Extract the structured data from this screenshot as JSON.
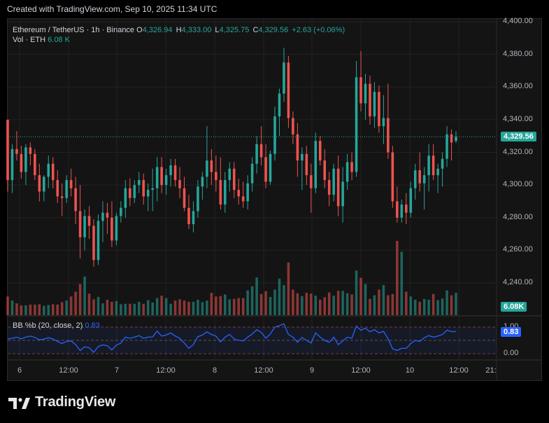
{
  "header": {
    "text": "Created with TradingView.com, Sep 10, 2025 11:34 UTC"
  },
  "legend": {
    "symbol": "Ethereum / TetherUS · 1h · Binance",
    "o_label": "O",
    "o": "4,326.94",
    "h_label": "H",
    "h": "4,333.00",
    "l_label": "L",
    "l": "4,325.75",
    "c_label": "C",
    "c": "4,329.56",
    "change": "+2.63 (+0.06%)",
    "vol_label": "Vol · ETH",
    "vol": "6.08 K"
  },
  "bb": {
    "label": "BB %b (20, close, 2)",
    "value": "0.83"
  },
  "badges": {
    "price": "4,329.56",
    "volume": "6.08K",
    "bb": "0.83"
  },
  "logo": {
    "text": "TradingView"
  },
  "colors": {
    "up": "#26a69a",
    "down": "#ef5350",
    "bb_line": "#2962ff",
    "bg": "#141414",
    "grid": "#222222"
  },
  "chart_data": {
    "type": "candlestick",
    "price_axis": {
      "labels": [
        "4,400.00",
        "4,380.00",
        "4,360.00",
        "4,340.00",
        "4,320.00",
        "4,300.00",
        "4,280.00",
        "4,260.00",
        "4,240.00"
      ],
      "ylim": [
        4231,
        4400
      ]
    },
    "bb_axis": {
      "labels": [
        "1.00",
        "0.00"
      ]
    },
    "time_axis": {
      "labels": [
        "6",
        "12:00",
        "7",
        "12:00",
        "8",
        "12:00",
        "9",
        "12:00",
        "10",
        "12:00",
        "21:"
      ]
    },
    "last_close": 4329.56,
    "candles_count": 100,
    "ohlc": [
      [
        4340,
        4340,
        4296,
        4303
      ],
      [
        4303,
        4325,
        4295,
        4322
      ],
      [
        4322,
        4333,
        4315,
        4319
      ],
      [
        4319,
        4324,
        4304,
        4308
      ],
      [
        4308,
        4325,
        4300,
        4323
      ],
      [
        4323,
        4326,
        4312,
        4319
      ],
      [
        4319,
        4322,
        4303,
        4306
      ],
      [
        4306,
        4313,
        4290,
        4296
      ],
      [
        4296,
        4306,
        4290,
        4305
      ],
      [
        4305,
        4318,
        4298,
        4313
      ],
      [
        4313,
        4317,
        4298,
        4303
      ],
      [
        4303,
        4309,
        4289,
        4293
      ],
      [
        4293,
        4301,
        4281,
        4292
      ],
      [
        4292,
        4306,
        4289,
        4303
      ],
      [
        4303,
        4310,
        4293,
        4298
      ],
      [
        4298,
        4305,
        4276,
        4284
      ],
      [
        4284,
        4300,
        4255,
        4268
      ],
      [
        4268,
        4285,
        4260,
        4281
      ],
      [
        4281,
        4287,
        4267,
        4275
      ],
      [
        4275,
        4279,
        4250,
        4254
      ],
      [
        4254,
        4282,
        4251,
        4278
      ],
      [
        4278,
        4290,
        4265,
        4283
      ],
      [
        4283,
        4289,
        4270,
        4280
      ],
      [
        4280,
        4290,
        4262,
        4266
      ],
      [
        4266,
        4283,
        4263,
        4281
      ],
      [
        4281,
        4290,
        4277,
        4286
      ],
      [
        4286,
        4303,
        4280,
        4298
      ],
      [
        4298,
        4304,
        4287,
        4292
      ],
      [
        4292,
        4303,
        4289,
        4300
      ],
      [
        4300,
        4308,
        4295,
        4303
      ],
      [
        4303,
        4307,
        4288,
        4293
      ],
      [
        4293,
        4301,
        4284,
        4297
      ],
      [
        4297,
        4310,
        4284,
        4298
      ],
      [
        4298,
        4317,
        4290,
        4311
      ],
      [
        4311,
        4317,
        4295,
        4300
      ],
      [
        4300,
        4310,
        4294,
        4306
      ],
      [
        4306,
        4316,
        4299,
        4312
      ],
      [
        4312,
        4316,
        4299,
        4303
      ],
      [
        4303,
        4311,
        4292,
        4298
      ],
      [
        4298,
        4305,
        4284,
        4286
      ],
      [
        4286,
        4294,
        4273,
        4276
      ],
      [
        4276,
        4290,
        4271,
        4284
      ],
      [
        4284,
        4303,
        4280,
        4299
      ],
      [
        4299,
        4308,
        4291,
        4305
      ],
      [
        4305,
        4336,
        4298,
        4315
      ],
      [
        4315,
        4322,
        4300,
        4308
      ],
      [
        4308,
        4318,
        4296,
        4303
      ],
      [
        4303,
        4317,
        4285,
        4288
      ],
      [
        4288,
        4308,
        4283,
        4303
      ],
      [
        4303,
        4314,
        4296,
        4310
      ],
      [
        4310,
        4314,
        4292,
        4297
      ],
      [
        4297,
        4304,
        4288,
        4293
      ],
      [
        4293,
        4302,
        4286,
        4290
      ],
      [
        4290,
        4306,
        4285,
        4301
      ],
      [
        4301,
        4317,
        4296,
        4313
      ],
      [
        4313,
        4330,
        4307,
        4325
      ],
      [
        4325,
        4336,
        4312,
        4317
      ],
      [
        4317,
        4325,
        4298,
        4302
      ],
      [
        4302,
        4321,
        4300,
        4319
      ],
      [
        4319,
        4348,
        4315,
        4342
      ],
      [
        4342,
        4359,
        4330,
        4356
      ],
      [
        4356,
        4384,
        4351,
        4375
      ],
      [
        4375,
        4379,
        4335,
        4341
      ],
      [
        4341,
        4345,
        4325,
        4331
      ],
      [
        4331,
        4338,
        4305,
        4315
      ],
      [
        4315,
        4323,
        4297,
        4319
      ],
      [
        4319,
        4324,
        4300,
        4306
      ],
      [
        4306,
        4313,
        4283,
        4298
      ],
      [
        4298,
        4332,
        4295,
        4327
      ],
      [
        4327,
        4330,
        4312,
        4315
      ],
      [
        4315,
        4322,
        4298,
        4303
      ],
      [
        4303,
        4308,
        4287,
        4294
      ],
      [
        4294,
        4313,
        4290,
        4310
      ],
      [
        4310,
        4318,
        4281,
        4287
      ],
      [
        4287,
        4311,
        4277,
        4302
      ],
      [
        4302,
        4319,
        4297,
        4314
      ],
      [
        4314,
        4320,
        4303,
        4308
      ],
      [
        4308,
        4376,
        4305,
        4366
      ],
      [
        4366,
        4382,
        4345,
        4350
      ],
      [
        4350,
        4368,
        4340,
        4362
      ],
      [
        4362,
        4367,
        4337,
        4342
      ],
      [
        4342,
        4363,
        4335,
        4357
      ],
      [
        4357,
        4361,
        4332,
        4336
      ],
      [
        4336,
        4355,
        4325,
        4341
      ],
      [
        4341,
        4362,
        4316,
        4320
      ],
      [
        4320,
        4324,
        4286,
        4290
      ],
      [
        4290,
        4299,
        4277,
        4280
      ],
      [
        4280,
        4291,
        4277,
        4288
      ],
      [
        4288,
        4295,
        4276,
        4283
      ],
      [
        4283,
        4302,
        4280,
        4298
      ],
      [
        4298,
        4313,
        4291,
        4309
      ],
      [
        4309,
        4320,
        4296,
        4301
      ],
      [
        4301,
        4311,
        4285,
        4306
      ],
      [
        4306,
        4325,
        4296,
        4318
      ],
      [
        4318,
        4325,
        4303,
        4306
      ],
      [
        4306,
        4313,
        4295,
        4310
      ],
      [
        4310,
        4320,
        4299,
        4316
      ],
      [
        4316,
        4336,
        4311,
        4331
      ],
      [
        4331,
        4334,
        4315,
        4326
      ],
      [
        4326.94,
        4333,
        4325.75,
        4329.56
      ]
    ],
    "volume": [
      4.6,
      3.6,
      2.9,
      2.4,
      2.4,
      2.6,
      2.6,
      2.7,
      2.3,
      2.5,
      2.7,
      2.6,
      3.2,
      3.6,
      4.6,
      5.8,
      7.7,
      9.5,
      5.3,
      3.9,
      4.5,
      2.9,
      3.8,
      3.3,
      3.5,
      2.7,
      2.8,
      2.8,
      2.8,
      3.3,
      2.8,
      3.7,
      3.1,
      4.2,
      4.8,
      4.2,
      2.8,
      3.6,
      3.9,
      3.6,
      3.3,
      3.3,
      3.8,
      3.2,
      3.6,
      5.5,
      4.6,
      4.7,
      5.1,
      3.9,
      4.0,
      4.2,
      4.2,
      6.1,
      7.1,
      9.3,
      5.2,
      5.9,
      4.5,
      6.3,
      9.0,
      7.4,
      13.0,
      6.3,
      5.4,
      4.7,
      5.5,
      5.3,
      4.8,
      3.8,
      4.4,
      5.6,
      4.8,
      6.0,
      6.0,
      5.4,
      5.1,
      11.0,
      9.2,
      7.7,
      4.0,
      4.9,
      6.3,
      7.4,
      4.9,
      5.2,
      18.3,
      15.6,
      5.8,
      4.6,
      3.8,
      3.3,
      4.0,
      3.8,
      5.2,
      3.7,
      4.1,
      6.1,
      4.9,
      5.5
    ],
    "vol_scale_max": 18.3,
    "bb_pctb": [
      0.55,
      0.58,
      0.62,
      0.56,
      0.62,
      0.66,
      0.61,
      0.52,
      0.55,
      0.6,
      0.55,
      0.46,
      0.38,
      0.46,
      0.48,
      0.34,
      0.12,
      0.26,
      0.22,
      0.05,
      0.27,
      0.33,
      0.3,
      0.14,
      0.32,
      0.4,
      0.62,
      0.58,
      0.62,
      0.68,
      0.58,
      0.62,
      0.63,
      0.85,
      0.66,
      0.7,
      0.78,
      0.66,
      0.58,
      0.4,
      0.2,
      0.34,
      0.64,
      0.7,
      0.82,
      0.72,
      0.66,
      0.44,
      0.62,
      0.72,
      0.55,
      0.5,
      0.48,
      0.62,
      0.74,
      0.9,
      0.8,
      0.58,
      0.74,
      1.0,
      1.05,
      1.12,
      0.72,
      0.62,
      0.43,
      0.61,
      0.5,
      0.4,
      0.78,
      0.62,
      0.5,
      0.42,
      0.62,
      0.34,
      0.48,
      0.62,
      0.58,
      1.04,
      0.88,
      0.96,
      0.82,
      0.9,
      0.78,
      0.84,
      0.56,
      0.18,
      0.12,
      0.2,
      0.2,
      0.38,
      0.5,
      0.46,
      0.6,
      0.68,
      0.62,
      0.66,
      0.72,
      0.88,
      0.83,
      0.83
    ],
    "bb_ylim": [
      -0.15,
      1.1
    ]
  }
}
